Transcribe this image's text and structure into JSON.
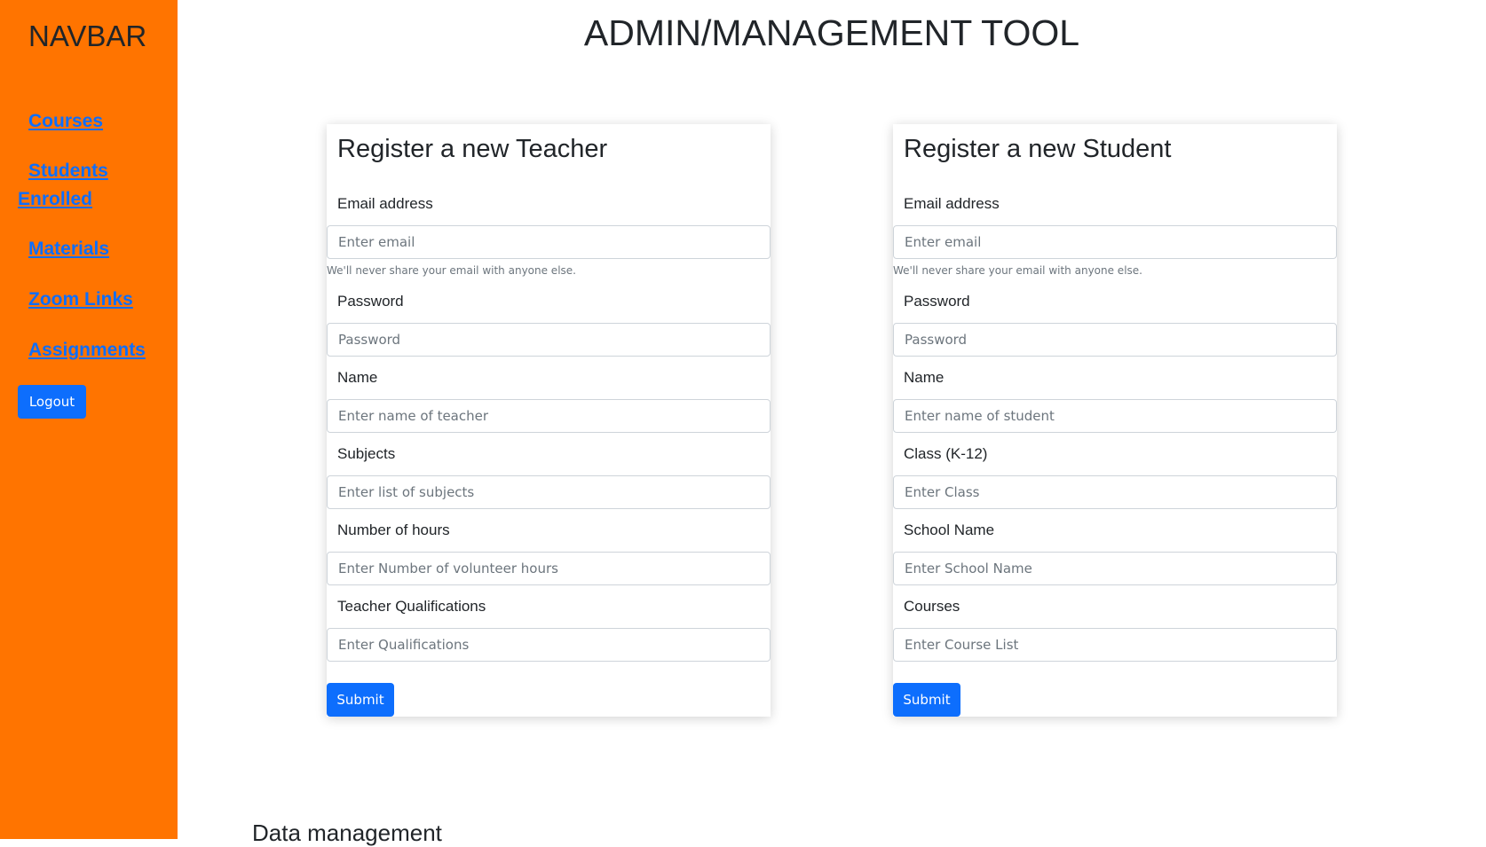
{
  "sidebar": {
    "brand": "NAVBAR",
    "links": [
      {
        "label": "Courses"
      },
      {
        "label_line1": "Students",
        "label_line2": "Enrolled"
      },
      {
        "label": "Materials"
      },
      {
        "label": "Zoom Links"
      },
      {
        "label": "Assignments"
      }
    ],
    "logout_label": "Logout",
    "background_color": "#ff7400",
    "link_color": "#0d6efd"
  },
  "header": {
    "title": "ADMIN/MANAGEMENT TOOL"
  },
  "teacher_form": {
    "title": "Register a new Teacher",
    "email_label": "Email address",
    "email_placeholder": "Enter email",
    "email_help": "We'll never share your email with anyone else.",
    "password_label": "Password",
    "password_placeholder": "Password",
    "name_label": "Name",
    "name_placeholder": "Enter name of teacher",
    "subjects_label": "Subjects",
    "subjects_placeholder": "Enter list of subjects",
    "hours_label": "Number of hours",
    "hours_placeholder": "Enter Number of volunteer hours",
    "qualifications_label": "Teacher Qualifications",
    "qualifications_placeholder": "Enter Qualifications",
    "submit_label": "Submit"
  },
  "student_form": {
    "title": "Register a new Student",
    "email_label": "Email address",
    "email_placeholder": "Enter email",
    "email_help": "We'll never share your email with anyone else.",
    "password_label": "Password",
    "password_placeholder": "Password",
    "name_label": "Name",
    "name_placeholder": "Enter name of student",
    "class_label": "Class (K-12)",
    "class_placeholder": "Enter Class",
    "school_label": "School Name",
    "school_placeholder": "Enter School Name",
    "courses_label": "Courses",
    "courses_placeholder": "Enter Course List",
    "submit_label": "Submit"
  },
  "data_management": {
    "heading": "Data management"
  },
  "colors": {
    "primary_button": "#0d6efd",
    "sidebar": "#ff7400"
  }
}
